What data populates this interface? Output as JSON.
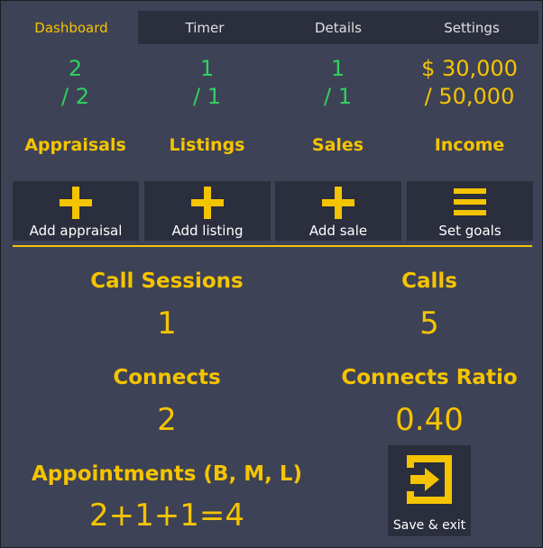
{
  "tabs": [
    "Dashboard",
    "Timer",
    "Details",
    "Settings"
  ],
  "active_tab": "Dashboard",
  "stats": [
    {
      "label": "Appraisals",
      "line1": "2",
      "line2": "/ 2",
      "color": "#2fd15e"
    },
    {
      "label": "Listings",
      "line1": "1",
      "line2": "/ 1",
      "color": "#2fd15e"
    },
    {
      "label": "Sales",
      "line1": "1",
      "line2": "/ 1",
      "color": "#2fd15e"
    },
    {
      "label": "Income",
      "line1": "$ 30,000",
      "line2": "/ 50,000",
      "color": "#f5c400"
    }
  ],
  "actions": [
    {
      "label": "Add appraisal",
      "icon": "plus-icon"
    },
    {
      "label": "Add listing",
      "icon": "plus-icon"
    },
    {
      "label": "Add sale",
      "icon": "plus-icon"
    },
    {
      "label": "Set goals",
      "icon": "menu-icon"
    }
  ],
  "metrics": {
    "call_sessions": {
      "title": "Call Sessions",
      "value": "1"
    },
    "calls": {
      "title": "Calls",
      "value": "5"
    },
    "connects": {
      "title": "Connects",
      "value": "2"
    },
    "connects_ratio": {
      "title": "Connects Ratio",
      "value": "0.40"
    },
    "appointments": {
      "title": "Appointments (B, M, L)",
      "value": "2+1+1=4"
    }
  },
  "save_exit": {
    "label": "Save & exit",
    "icon": "exit-icon"
  },
  "colors": {
    "accent": "#f5c400",
    "success": "#2fd15e",
    "background": "#3e4256",
    "panel": "#2b2e3d"
  }
}
